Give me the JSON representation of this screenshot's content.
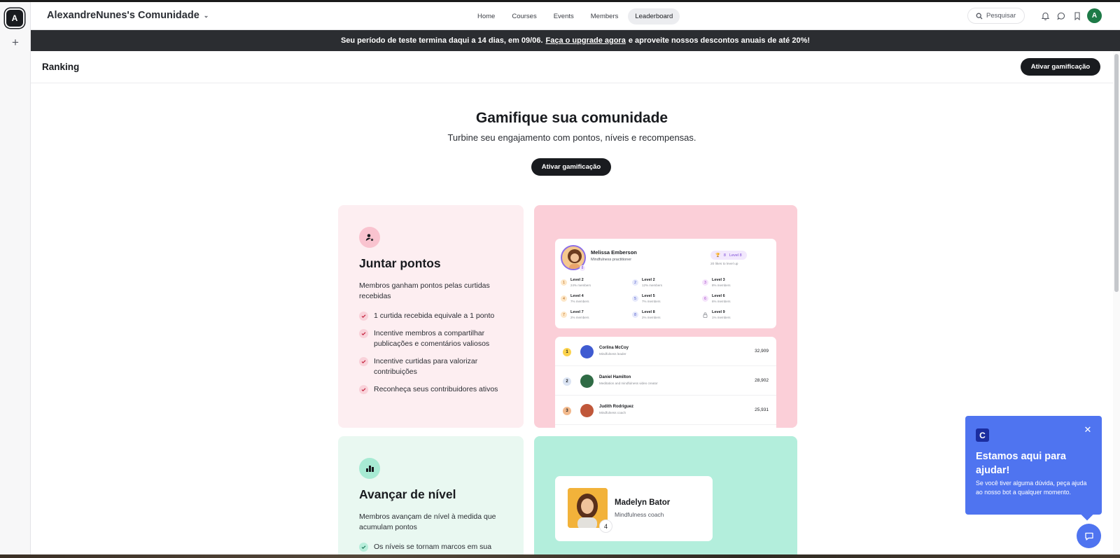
{
  "rail": {
    "workspace_initial": "A",
    "add_symbol": "+"
  },
  "header": {
    "community_name": "AlexandreNunes's Comunidade",
    "nav": [
      {
        "label": "Home",
        "active": false
      },
      {
        "label": "Courses",
        "active": false
      },
      {
        "label": "Events",
        "active": false
      },
      {
        "label": "Members",
        "active": false
      },
      {
        "label": "Leaderboard",
        "active": true
      }
    ],
    "search_label": "Pesquisar",
    "avatar_initial": "A",
    "avatar_color": "#1d7a47"
  },
  "trial_banner": {
    "text_before": "Seu período de teste termina daqui a 14 dias, em 09/06.",
    "link_text": "Faça o upgrade agora",
    "text_after": "e aproveite nossos descontos anuais de até 20%!"
  },
  "page": {
    "title": "Ranking",
    "activate_button": "Ativar gamificação"
  },
  "hero": {
    "title": "Gamifique sua comunidade",
    "subtitle": "Turbine seu engajamento com pontos, níveis e recompensas.",
    "button": "Ativar gamificação"
  },
  "features": [
    {
      "title": "Juntar pontos",
      "description": "Membros ganham pontos pelas curtidas recebidas",
      "bullets": [
        "1 curtida recebida equivale a 1 ponto",
        "Incentive membros a compartilhar publicações e comentários valiosos",
        "Incentive curtidas para valorizar contribuições",
        "Reconheça seus contribuidores ativos"
      ]
    },
    {
      "title": "Avançar de nível",
      "description": "Membros avançam de nível à medida que acumulam pontos",
      "bullets": [
        "Os níveis se tornam marcos em sua"
      ]
    }
  ],
  "mock_profile": {
    "name": "Melissa Emberson",
    "role": "Mindfulness practitioner",
    "badge_level_number": "8",
    "pill_points": "8",
    "pill_level": "Level 8",
    "to_level_text": "20 likes to level up",
    "levels": [
      {
        "num": "1",
        "label": "Level 2",
        "members": "24% members"
      },
      {
        "num": "4",
        "label": "Level 4",
        "members": "7% members"
      },
      {
        "num": "7",
        "label": "Level 7",
        "members": "2% members"
      },
      {
        "num": "2",
        "label": "Level 2",
        "members": "12% members"
      },
      {
        "num": "5",
        "label": "Level 5",
        "members": "7% members"
      },
      {
        "num": "8",
        "label": "Level 8",
        "members": "2% members"
      },
      {
        "num": "3",
        "label": "Level 3",
        "members": "8% members"
      },
      {
        "num": "6",
        "label": "Level 6",
        "members": "6% members"
      },
      {
        "num": "",
        "label": "Level 9",
        "members": "1% members"
      }
    ]
  },
  "mock_leaderboard": [
    {
      "rank": "1",
      "name": "Corlina McCoy",
      "role": "Mindfulness leader",
      "points": "32,909",
      "rank_color": "#fcd34d",
      "avatar_color": "#3f5bd1"
    },
    {
      "rank": "2",
      "name": "Daniel Hamilton",
      "role": "Meditation and mindfulness video creator",
      "points": "28,902",
      "rank_color": "#dbe4f3",
      "avatar_color": "#2f6b45"
    },
    {
      "rank": "3",
      "name": "Judith Rodriguez",
      "role": "Mindfulness coach",
      "points": "25,931",
      "rank_color": "#f2b98c",
      "avatar_color": "#c0573a"
    }
  ],
  "mock_level_card": {
    "name": "Madelyn Bator",
    "role": "Mindfulness coach",
    "level": "4"
  },
  "help_widget": {
    "logo_letter": "C",
    "title": "Estamos aqui para ajudar!",
    "body": "Se você tiver alguma dúvida, peça ajuda ao nosso bot a qualquer momento.",
    "color": "#4f74f0"
  }
}
